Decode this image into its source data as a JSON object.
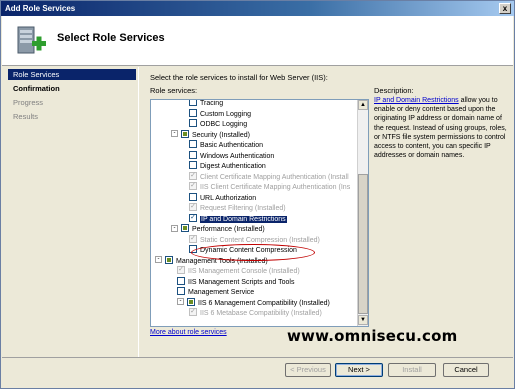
{
  "window": {
    "title": "Add Role Services",
    "close_glyph": "x"
  },
  "header": {
    "title": "Select Role Services",
    "icon": "server-add-icon"
  },
  "nav": {
    "items": [
      {
        "label": "Role Services",
        "state": "active"
      },
      {
        "label": "Confirmation",
        "state": "bold"
      },
      {
        "label": "Progress",
        "state": "dim"
      },
      {
        "label": "Results",
        "state": "dim"
      }
    ]
  },
  "main": {
    "instruction": "Select the role services to install for Web Server (IIS):",
    "tree_label": "Role services:",
    "description_label": "Description:",
    "description_link": "IP and Domain Restrictions",
    "description_text": " allow you to enable or deny content based upon the originating IP address or domain name of the request. Instead of using groups, roles, or NTFS file system permissions to control access to content, you can specific IP addresses or domain names.",
    "more_link": "More about role services"
  },
  "tree": {
    "items": [
      {
        "label": "Tracing",
        "check": "none",
        "enabled": true
      },
      {
        "label": "Custom Logging",
        "check": "none",
        "enabled": true
      },
      {
        "label": "ODBC Logging",
        "check": "none",
        "enabled": true
      },
      {
        "label": "Security  (Installed)",
        "check": "partial",
        "enabled": true,
        "expander": "-"
      },
      {
        "label": "Basic Authentication",
        "check": "none",
        "enabled": true
      },
      {
        "label": "Windows Authentication",
        "check": "none",
        "enabled": true
      },
      {
        "label": "Digest Authentication",
        "check": "none",
        "enabled": true
      },
      {
        "label": "Client Certificate Mapping Authentication  (Install",
        "check": "checked",
        "enabled": false
      },
      {
        "label": "IIS Client Certificate Mapping Authentication  (Ins",
        "check": "checked",
        "enabled": false
      },
      {
        "label": "URL Authorization",
        "check": "none",
        "enabled": true
      },
      {
        "label": "Request Filtering  (Installed)",
        "check": "checked",
        "enabled": false
      },
      {
        "label": "IP and Domain Restrictions",
        "check": "checked",
        "enabled": true,
        "selected": true
      },
      {
        "label": "Performance  (Installed)",
        "check": "partial",
        "enabled": true,
        "expander": "-"
      },
      {
        "label": "Static Content Compression  (Installed)",
        "check": "checked",
        "enabled": false
      },
      {
        "label": "Dynamic Content Compression",
        "check": "none",
        "enabled": true
      },
      {
        "label": "Management Tools  (Installed)",
        "check": "partial",
        "enabled": true,
        "expander": "-"
      },
      {
        "label": "IIS Management Console  (Installed)",
        "check": "checked",
        "enabled": false
      },
      {
        "label": "IIS Management Scripts and Tools",
        "check": "none",
        "enabled": true
      },
      {
        "label": "Management Service",
        "check": "none",
        "enabled": true
      },
      {
        "label": "IIS 6 Management Compatibility  (Installed)",
        "check": "partial",
        "enabled": true,
        "expander": "-"
      },
      {
        "label": "IIS 6 Metabase Compatibility  (Installed)",
        "check": "checked",
        "enabled": false
      }
    ]
  },
  "buttons": {
    "previous": "< Previous",
    "next": "Next >",
    "install": "Install",
    "cancel": "Cancel"
  },
  "watermark": "www.omnisecu.com",
  "colors": {
    "selection": "#0a246a",
    "highlight_oval": "#c00000",
    "link": "#0000cc"
  }
}
